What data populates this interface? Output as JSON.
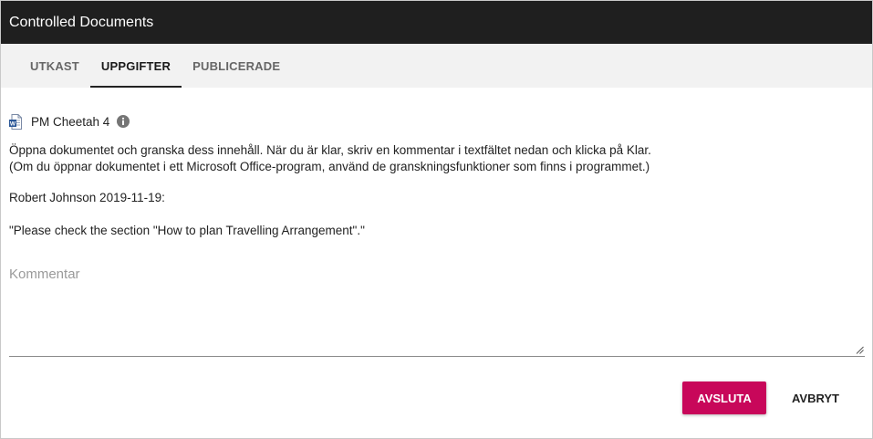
{
  "window": {
    "title": "Controlled Documents"
  },
  "tabs": [
    {
      "label": "UTKAST",
      "active": false
    },
    {
      "label": "UPPGIFTER",
      "active": true
    },
    {
      "label": "PUBLICERADE",
      "active": false
    }
  ],
  "document": {
    "name": "PM Cheetah 4",
    "icon": "word-document-icon"
  },
  "instructions": {
    "line1": "Öppna dokumentet och granska dess innehåll. När du är klar, skriv en kommentar i textfältet nedan och klicka på Klar.",
    "line2": "(Om du öppnar dokumentet i ett Microsoft Office-program, använd de granskningsfunktioner som finns i programmet.)"
  },
  "message": {
    "author_line": "Robert Johnson 2019-11-19:",
    "quote": "\"Please check the section \"How to plan Travelling Arrangement\".\""
  },
  "comment": {
    "placeholder": "Kommentar",
    "value": ""
  },
  "buttons": {
    "finish": "AVSLUTA",
    "cancel": "AVBRYT"
  },
  "colors": {
    "accent": "#c8075a",
    "titlebar": "#1f1f1f",
    "tabbar": "#f2f2f2"
  }
}
